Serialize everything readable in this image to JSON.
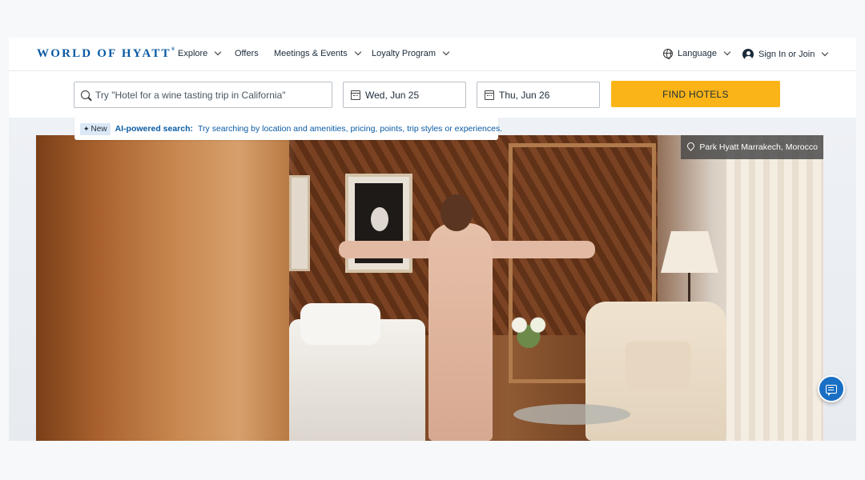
{
  "brand": {
    "logo_text": "WORLD OF HYATT",
    "logo_mark": "®"
  },
  "nav": {
    "items": [
      {
        "label": "Explore",
        "has_dropdown": true
      },
      {
        "label": "Offers",
        "has_dropdown": false
      },
      {
        "label": "Meetings & Events",
        "has_dropdown": true
      },
      {
        "label": "Loyalty Program",
        "has_dropdown": true
      }
    ],
    "language_label": "Language",
    "signin_label": "Sign In or Join"
  },
  "search": {
    "placeholder": "Try \"Hotel for a wine tasting trip in California\"",
    "checkin": "Wed, Jun 25",
    "checkout": "Thu, Jun 26",
    "find_label": "FIND HOTELS"
  },
  "ai_banner": {
    "badge": "New",
    "strong": "AI-powered search:",
    "text": "Try searching by location and amenities, pricing, points, trip styles or experiences."
  },
  "hero": {
    "location": "Park Hyatt Marrakech, Morocco"
  },
  "colors": {
    "brand_blue": "#0a5aa5",
    "cta_yellow": "#fbb418",
    "chat_blue": "#1a6fc4"
  }
}
